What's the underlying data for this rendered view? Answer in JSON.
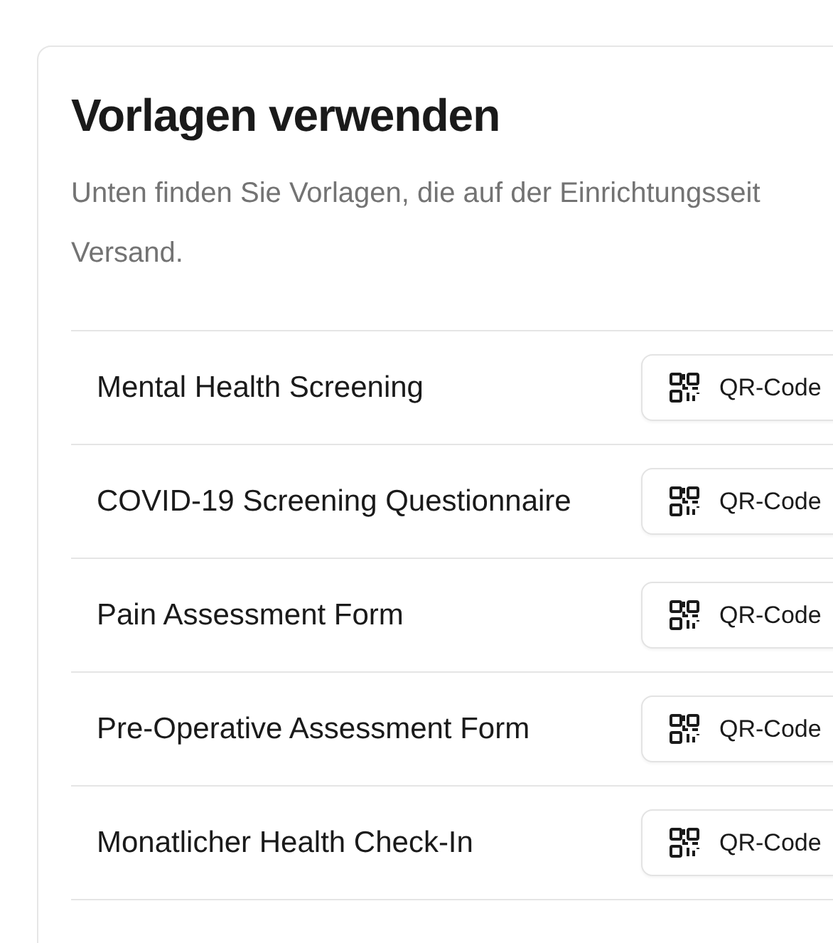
{
  "card": {
    "title": "Vorlagen verwenden",
    "description_lines": [
      "Unten finden Sie Vorlagen, die auf der Einrichtungsseit",
      "Versand."
    ],
    "templates": [
      {
        "name": "Mental Health Screening",
        "button": "QR-Code"
      },
      {
        "name": "COVID-19 Screening Questionnaire",
        "button": "QR-Code"
      },
      {
        "name": "Pain Assessment Form",
        "button": "QR-Code"
      },
      {
        "name": "Pre-Operative Assessment Form",
        "button": "QR-Code"
      },
      {
        "name": "Monatlicher Health Check-In",
        "button": "QR-Code"
      }
    ]
  }
}
